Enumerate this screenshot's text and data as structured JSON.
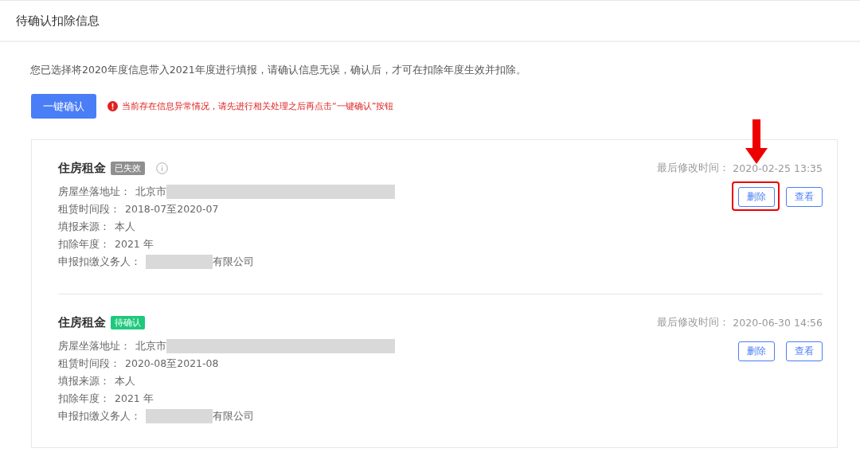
{
  "header": {
    "title": "待确认扣除信息"
  },
  "intro": "您已选择将2020年度信息带入2021年度进行填报，请确认信息无误，确认后，才可在扣除年度生效并扣除。",
  "confirm_button": "一键确认",
  "warning": "当前存在信息异常情况，请先进行相关处理之后再点击“一键确认”按钮",
  "records": [
    {
      "title": "住房租金",
      "status": {
        "kind": "expired",
        "label": "已失效"
      },
      "info_icon": true,
      "modified_label": "最后修改时间：",
      "modified_time": "2020-02-25 13:35",
      "highlighted": true,
      "fields": [
        {
          "label": "房屋坐落地址：",
          "value": "北京市",
          "kind": "masked_tail"
        },
        {
          "label": "租赁时间段：",
          "value": "2018-07至2020-07",
          "kind": "plain"
        },
        {
          "label": "填报来源：",
          "value": "本人",
          "kind": "plain"
        },
        {
          "label": "扣除年度：",
          "value": "2021 年",
          "kind": "plain"
        },
        {
          "label": "申报扣缴义务人：",
          "value": "有限公司",
          "kind": "masked_head"
        }
      ],
      "buttons": [
        "删除",
        "查看"
      ]
    },
    {
      "title": "住房租金",
      "status": {
        "kind": "pending",
        "label": "待确认"
      },
      "info_icon": false,
      "modified_label": "最后修改时间：",
      "modified_time": "2020-06-30 14:56",
      "highlighted": false,
      "fields": [
        {
          "label": "房屋坐落地址：",
          "value": "北京市",
          "kind": "masked_tail"
        },
        {
          "label": "租赁时间段：",
          "value": "2020-08至2021-08",
          "kind": "plain"
        },
        {
          "label": "填报来源：",
          "value": "本人",
          "kind": "plain"
        },
        {
          "label": "扣除年度：",
          "value": "2021 年",
          "kind": "plain"
        },
        {
          "label": "申报扣缴义务人：",
          "value": "有限公司",
          "kind": "masked_head"
        }
      ],
      "buttons": [
        "删除",
        "查看"
      ]
    }
  ]
}
